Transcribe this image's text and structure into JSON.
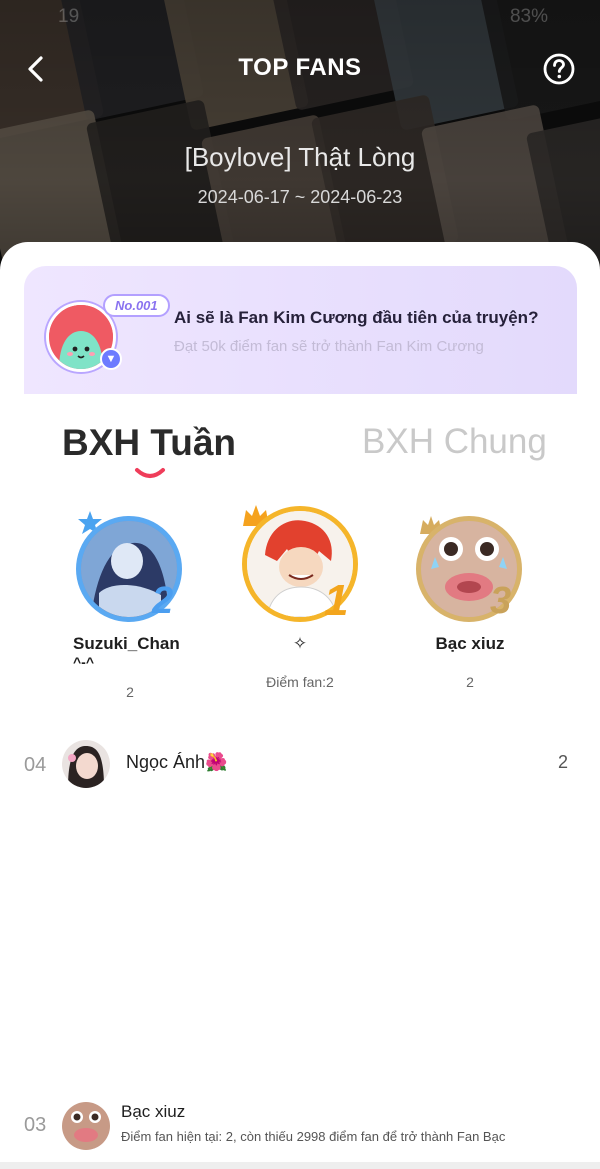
{
  "status_bar": {
    "time": "19",
    "battery": "83%"
  },
  "header": {
    "title": "TOP FANS",
    "series_title": "[Boylove] Thật Lòng",
    "date_range": "2024-06-17 ~ 2024-06-23"
  },
  "promo": {
    "badge": "No.001",
    "title": "Ai sẽ là Fan Kim Cương đầu tiên của truyện?",
    "subtitle": "Đạt 50k điểm fan sẽ trở thành Fan Kim Cương"
  },
  "tabs": [
    {
      "label": "BXH Tuần",
      "active": true
    },
    {
      "label": "BXH Chung",
      "active": false
    }
  ],
  "podium": {
    "first": {
      "rank": "1",
      "name": "✧",
      "score": "Điểm fan:2",
      "ring_color": "#f5b52a"
    },
    "second": {
      "rank": "2",
      "name": "Suzuki_Chan",
      "name_line2": "^-^",
      "score": "2",
      "ring_color": "#5aa9f2"
    },
    "third": {
      "rank": "3",
      "name": "Bạc xiuz",
      "score": "2",
      "ring_color": "#d8b36a"
    }
  },
  "list": [
    {
      "rank": "04",
      "name": "Ngọc Ánh🌺",
      "score": "2"
    }
  ],
  "my_rank": {
    "rank": "03",
    "name": "Bạc xiuz",
    "description": "Điểm fan hiện tại: 2, còn thiếu 2998 điểm fan để trở thành Fan Bạc"
  }
}
